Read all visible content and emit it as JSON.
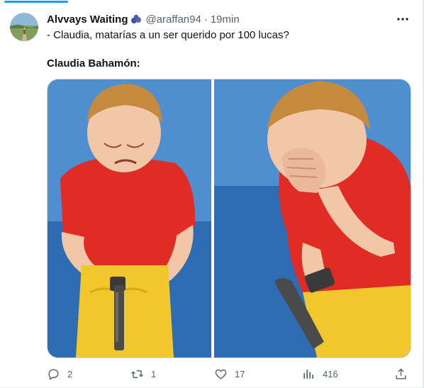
{
  "tweet": {
    "author_name": "Alvvays Waiting",
    "emoji": "🫐",
    "handle": "@araffan94",
    "separator": "·",
    "time": "19min",
    "text_line1": "- Claudia, matarías a un ser querido por 100 lucas?",
    "text_line2": "Claudia Bahamón:"
  },
  "actions": {
    "reply_count": "2",
    "retweet_count": "1",
    "like_count": "17",
    "views_count": "416"
  },
  "icons": {
    "avatar": "avatar",
    "more": "more-icon",
    "reply": "reply-icon",
    "retweet": "retweet-icon",
    "like": "heart-icon",
    "views": "views-icon",
    "share": "share-icon"
  },
  "colors": {
    "accent": "#1d9bf0",
    "text_primary": "#0f1419",
    "text_secondary": "#536471",
    "border": "#cfd9de"
  }
}
